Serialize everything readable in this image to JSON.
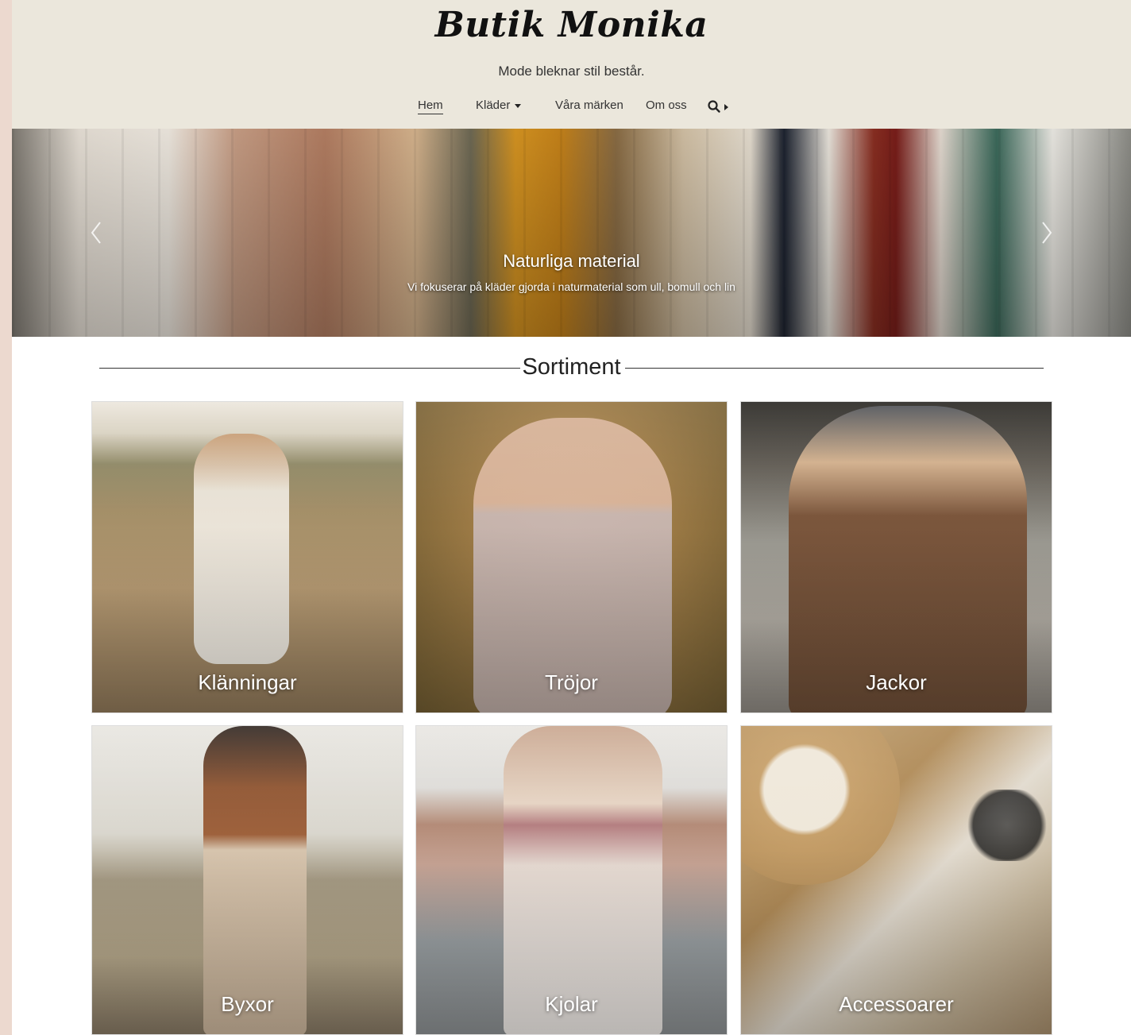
{
  "header": {
    "logo": "Butik Monika",
    "tagline": "Mode bleknar stil består."
  },
  "nav": {
    "items": [
      {
        "label": "Hem",
        "active": true
      },
      {
        "label": "Kläder",
        "dropdown": true
      },
      {
        "label": "Våra märken"
      },
      {
        "label": "Om oss"
      }
    ],
    "search_icon": "search-icon"
  },
  "hero": {
    "title": "Naturliga material",
    "text": "Vi fokuserar på kläder gjorda i naturmaterial som ull, bomull och lin"
  },
  "section": {
    "title": "Sortiment"
  },
  "categories": [
    {
      "label": "Klänningar"
    },
    {
      "label": "Tröjor"
    },
    {
      "label": "Jackor"
    },
    {
      "label": "Byxor"
    },
    {
      "label": "Kjolar"
    },
    {
      "label": "Accessoarer"
    }
  ],
  "colors": {
    "header_bg": "#ebe7dc",
    "side_bg": "#ecd9cf",
    "text": "#222222"
  }
}
